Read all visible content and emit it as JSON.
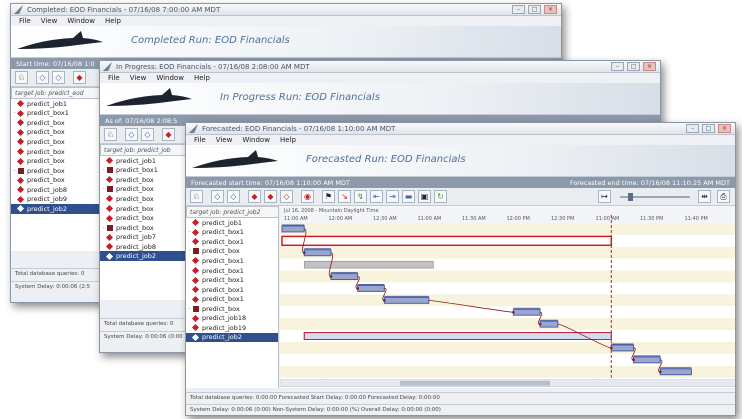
{
  "windows": {
    "completed": {
      "title": "Completed: EOD Financials - 07/16/08 7:00:00 AM MDT",
      "menu": [
        "File",
        "View",
        "Window",
        "Help"
      ],
      "banner": "Completed Run: EOD Financials",
      "start_label": "Start time: 07/16/08 1:0",
      "target": "target job: predict_eod",
      "rows": [
        {
          "label": "predict_job1",
          "icon": "diamond",
          "toggle": ""
        },
        {
          "label": "predict_box1",
          "icon": "diamond",
          "toggle": "-"
        },
        {
          "label": "predict_box",
          "icon": "diamond",
          "toggle": ""
        },
        {
          "label": "predict_box",
          "icon": "diamond",
          "toggle": ""
        },
        {
          "label": "predict_box",
          "icon": "diamond",
          "toggle": ""
        },
        {
          "label": "predict_box",
          "icon": "diamond",
          "toggle": ""
        },
        {
          "label": "predict_box",
          "icon": "diamond",
          "toggle": ""
        },
        {
          "label": "predict_box",
          "icon": "box",
          "toggle": "-"
        },
        {
          "label": "predict_box",
          "icon": "diamond",
          "toggle": ""
        },
        {
          "label": "predict_job8",
          "icon": "diamond",
          "toggle": ""
        },
        {
          "label": "predict_job9",
          "icon": "diamond",
          "toggle": ""
        },
        {
          "label": "predict_job2",
          "icon": "diamond",
          "toggle": "",
          "selected": true
        }
      ],
      "status1": "Total database queries: 0",
      "status2": "System Delay: 0:00:06 (2:5"
    },
    "in_progress": {
      "title": "In Progress: EOD Financials - 07/16/08 2:08:00 AM MDT",
      "menu": [
        "File",
        "View",
        "Window",
        "Help"
      ],
      "banner": "In Progress Run: EOD Financials",
      "as_of": "As of: 07/16/08 2:08:5",
      "target": "target job: predict_job",
      "rows": [
        {
          "label": "predict_job1",
          "icon": "diamond",
          "toggle": ""
        },
        {
          "label": "predict_box1",
          "icon": "box",
          "toggle": "-"
        },
        {
          "label": "predict_box",
          "icon": "diamond",
          "toggle": ""
        },
        {
          "label": "predict_box",
          "icon": "box",
          "toggle": "-"
        },
        {
          "label": "predict_box",
          "icon": "diamond",
          "toggle": ""
        },
        {
          "label": "predict_box",
          "icon": "diamond",
          "toggle": ""
        },
        {
          "label": "predict_box",
          "icon": "diamond",
          "toggle": ""
        },
        {
          "label": "predict_box",
          "icon": "box",
          "toggle": "-"
        },
        {
          "label": "predict_job7",
          "icon": "diamond",
          "toggle": ""
        },
        {
          "label": "predict_job8",
          "icon": "diamond",
          "toggle": ""
        },
        {
          "label": "predict_job2",
          "icon": "diamond",
          "toggle": "",
          "selected": true
        }
      ],
      "status1": "Total database queries: 0",
      "status2": "System Delay: 0:00:06 (0:00"
    },
    "forecasted": {
      "title": "Forecasted: EOD Financials - 07/16/08 1:10:00 AM MDT",
      "menu": [
        "File",
        "View",
        "Window",
        "Help"
      ],
      "banner": "Forecasted Run: EOD Financials",
      "start_label": "Forecasted start time: 07/16/08 1:10:00 AM MDT",
      "end_label": "Forecasted end time: 07/16/08 11:10:25 AM MDT",
      "target": "target job: predict_job2",
      "rows": [
        {
          "label": "predict_job1",
          "icon": "diamond",
          "toggle": ""
        },
        {
          "label": "predict_box1",
          "icon": "diamond",
          "toggle": "-"
        },
        {
          "label": "predict_box1",
          "icon": "diamond",
          "toggle": ""
        },
        {
          "label": "predict_box",
          "icon": "box",
          "toggle": "-"
        },
        {
          "label": "predict_box1",
          "icon": "diamond",
          "toggle": ""
        },
        {
          "label": "predict_box1",
          "icon": "diamond",
          "toggle": ""
        },
        {
          "label": "predict_box1",
          "icon": "diamond",
          "toggle": ""
        },
        {
          "label": "predict_box1",
          "icon": "diamond",
          "toggle": ""
        },
        {
          "label": "predict_box1",
          "icon": "diamond",
          "toggle": ""
        },
        {
          "label": "predict_box",
          "icon": "box",
          "toggle": "-"
        },
        {
          "label": "predict_job18",
          "icon": "diamond",
          "toggle": ""
        },
        {
          "label": "predict_job19",
          "icon": "diamond",
          "toggle": ""
        },
        {
          "label": "predict_job2",
          "icon": "diamond",
          "toggle": "",
          "selected": true
        }
      ],
      "date_label": "Jul 16, 2008 - Mountain Daylight Time",
      "time_ticks": [
        "11:00 AM",
        "12:00 AM",
        "12:30 AM",
        "11:00 AM",
        "11:30 AM",
        "12:00 PM",
        "12:30 PM",
        "11:00 AM",
        "11:30 PM",
        "11:40 PM"
      ],
      "status1": "Total database queries: 0:00:00 Forecasted Start Delay: 0:00:00 Forecasted Delay: 0:00:00",
      "status2": "System Delay: 0:00:06 (0:00) Non-System Delay: 0:00:00 (%) Overall Delay: 0:00:00 (0:00)"
    }
  },
  "colors": {
    "accent_red": "#c2202a",
    "bar_blue": "#4a5fa8",
    "target_line": "#d11b1b",
    "row_alt": "#f7f3dc"
  },
  "chart_data": {
    "type": "gantt",
    "date_label": "Jul 16, 2008 - Mountain Daylight Time",
    "ticks": [
      "11:00 AM",
      "12:00 AM",
      "12:30 AM",
      "11:00 AM",
      "11:30 AM",
      "12:00 PM",
      "12:30 PM",
      "11:00 AM",
      "11:30 PM",
      "11:40 PM"
    ],
    "x_range": [
      0,
      10
    ],
    "target_marker": 7.4,
    "bars": [
      {
        "row": 0,
        "start": 0.0,
        "end": 0.5,
        "kind": "job"
      },
      {
        "row": 1,
        "start": 0.0,
        "end": 7.4,
        "kind": "box"
      },
      {
        "row": 2,
        "start": 0.5,
        "end": 1.1,
        "kind": "job"
      },
      {
        "row": 3,
        "start": 0.5,
        "end": 3.4,
        "kind": "box-gray"
      },
      {
        "row": 4,
        "start": 1.1,
        "end": 1.7,
        "kind": "job"
      },
      {
        "row": 5,
        "start": 1.7,
        "end": 2.3,
        "kind": "job"
      },
      {
        "row": 6,
        "start": 2.3,
        "end": 3.3,
        "kind": "job"
      },
      {
        "row": 7,
        "start": 5.2,
        "end": 5.8,
        "kind": "job"
      },
      {
        "row": 8,
        "start": 5.8,
        "end": 6.2,
        "kind": "job"
      },
      {
        "row": 9,
        "start": 0.5,
        "end": 7.4,
        "kind": "box-blue"
      },
      {
        "row": 10,
        "start": 7.4,
        "end": 7.9,
        "kind": "job"
      },
      {
        "row": 11,
        "start": 7.9,
        "end": 8.5,
        "kind": "job"
      },
      {
        "row": 12,
        "start": 8.5,
        "end": 9.2,
        "kind": "job"
      }
    ]
  }
}
